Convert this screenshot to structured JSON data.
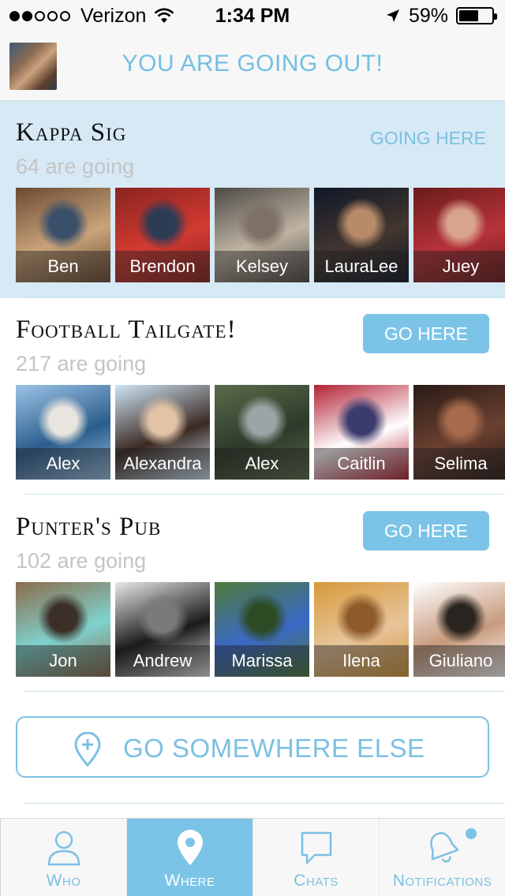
{
  "status_bar": {
    "carrier": "Verizon",
    "time": "1:34 PM",
    "battery": "59%",
    "battery_level": 0.59
  },
  "header": {
    "title": "YOU ARE GOING OUT!"
  },
  "venues": [
    {
      "name": "Kappa Sig",
      "going": "64 are going",
      "action": "GOING HERE",
      "people": [
        {
          "name": "Ben",
          "colors": [
            "#6b4a33",
            "#c9a47a",
            "#3a4f6a"
          ]
        },
        {
          "name": "Brendon",
          "colors": [
            "#8a2420",
            "#d23a31",
            "#2d3b55"
          ]
        },
        {
          "name": "Kelsey",
          "colors": [
            "#4d4a45",
            "#bfb3a3",
            "#7d7165"
          ]
        },
        {
          "name": "LauraLee",
          "colors": [
            "#101828",
            "#43362f",
            "#b78a68"
          ]
        },
        {
          "name": "Juey",
          "colors": [
            "#6a1c1a",
            "#b8323a",
            "#d9a48d"
          ]
        }
      ]
    },
    {
      "name": "Football Tailgate!",
      "going": "217 are going",
      "action": "GO HERE",
      "people": [
        {
          "name": "Alex",
          "colors": [
            "#9cc3e6",
            "#2b5d8c",
            "#e9e6df"
          ]
        },
        {
          "name": "Alexandra",
          "colors": [
            "#cfe6f7",
            "#3b2a22",
            "#e2c3a6"
          ]
        },
        {
          "name": "Alex",
          "colors": [
            "#5a6b4a",
            "#2c3a2a",
            "#9aa6a6"
          ]
        },
        {
          "name": "Caitlin",
          "colors": [
            "#b22234",
            "#ffffff",
            "#3c3b6e"
          ]
        },
        {
          "name": "Selima",
          "colors": [
            "#2a1b17",
            "#6b4030",
            "#a66a4d"
          ]
        }
      ]
    },
    {
      "name": "Punter's Pub",
      "going": "102 are going",
      "action": "GO HERE",
      "people": [
        {
          "name": "Jon",
          "colors": [
            "#8b6c4a",
            "#7fd2cf",
            "#3b2f28"
          ]
        },
        {
          "name": "Andrew",
          "colors": [
            "#e8e8e8",
            "#1a1a1a",
            "#7a7a7a"
          ]
        },
        {
          "name": "Marissa",
          "colors": [
            "#4f7a3b",
            "#3a69c8",
            "#2c4a24"
          ]
        },
        {
          "name": "Ilena",
          "colors": [
            "#d79a3a",
            "#e6c49a",
            "#8d5a2a"
          ]
        },
        {
          "name": "Giuliano",
          "colors": [
            "#ffffff",
            "#c79a7c",
            "#2a2420"
          ]
        }
      ]
    }
  ],
  "go_somewhere_else": "GO SOMEWHERE ELSE",
  "tabs": [
    {
      "label": "Who",
      "icon": "person-icon",
      "active": false
    },
    {
      "label": "Where",
      "icon": "map-pin-icon",
      "active": true
    },
    {
      "label": "Chats",
      "icon": "chat-bubble-icon",
      "active": false
    },
    {
      "label": "Notifications",
      "icon": "bell-icon",
      "active": false
    }
  ],
  "colors": {
    "accent": "#7cc4e7",
    "highlight": "#d6e9f5",
    "muted_text": "#c4c4c4"
  }
}
